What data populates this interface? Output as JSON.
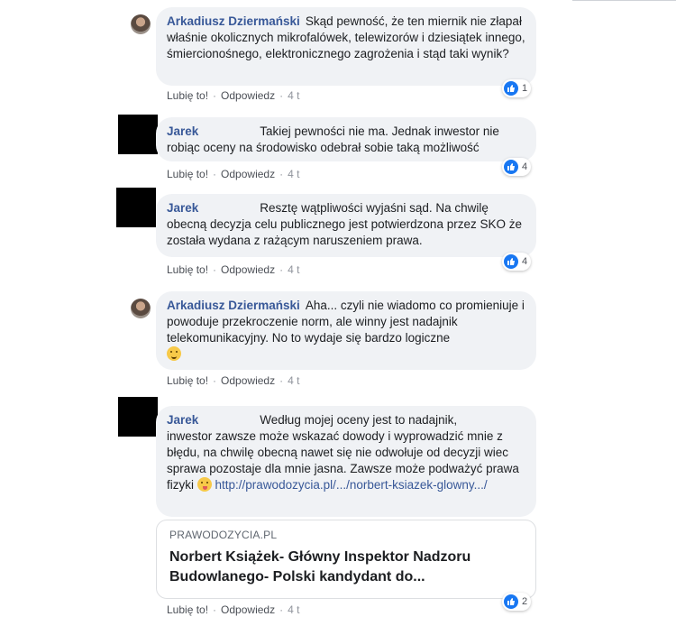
{
  "actions": {
    "like": "Lubię to!",
    "reply": "Odpowiedz",
    "separator": "·"
  },
  "comments": [
    {
      "author": "Arkadiusz Dziermański",
      "text": "Skąd pewność, że ten miernik nie złapał właśnie okolicznych mikrofalówek, telewizorów i dziesiątek innego, śmiercionośnego, elektronicznego zagrożenia i stąd taki wynik?",
      "time": "4 t",
      "reactions": "1"
    },
    {
      "author": "Jarek",
      "text_line1": "Takiej pewności nie ma. Jednak inwestor nie",
      "text_rest": "robiąc oceny na środowisko odebrał sobie taką możliwość",
      "time": "4 t",
      "reactions": "4"
    },
    {
      "author": "Jarek",
      "text_line1": "Resztę wątpliwości wyjaśni sąd. Na chwilę",
      "text_rest": "obecną decyzja celu publicznego jest potwierdzona przez SKO że została wydana z rażącym naruszeniem prawa.",
      "time": "4 t",
      "reactions": "4"
    },
    {
      "author": "Arkadiusz Dziermański",
      "text": "Aha... czyli nie wiadomo co promieniuje i powoduje przekroczenie norm, ale winny jest nadajnik telekomunikacyjny. No to wydaje się bardzo logiczne",
      "emoji": "thinking-face",
      "time": "4 t"
    },
    {
      "author": "Jarek",
      "text_line1": "Według mojej oceny jest to nadajnik,",
      "text_rest": "inwestor zawsze może wskazać dowody i wyprowadzić mnie z błędu, na chwilę obecną nawet się nie odwołuje od decyzji wiec sprawa pozostaje dla mnie jasna. Zawsze może podważyć prawa fizyki",
      "emoji": "tongue-face",
      "link": "http://prawodozycia.pl/.../norbert-ksiazek-glowny.../",
      "time": "4 t",
      "reactions": "2",
      "preview": {
        "domain": "PRAWODOZYCIA.PL",
        "title": "Norbert Książek- Główny Inspektor Nadzoru Budowlanego- Polski kandydant do..."
      }
    }
  ],
  "colors": {
    "author": "#385898",
    "bubble": "#f0f2f5",
    "like": "#1877f2"
  }
}
